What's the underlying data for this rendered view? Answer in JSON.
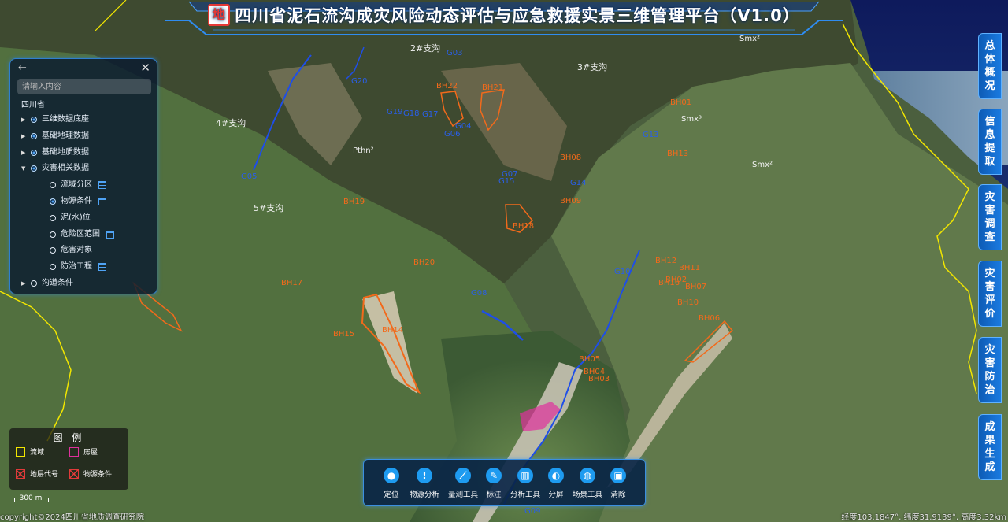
{
  "app": {
    "title": "四川省泥石流沟成灾风险动态评估与应急救援实景三维管理平台（V1.0）",
    "logo_char": "地",
    "accent_color": "#1a7ae0",
    "title_glow_color": "#0a3b8c"
  },
  "layer_panel": {
    "search_placeholder": "请输入内容",
    "root_label": "四川省",
    "back_icon": "arrow-left-icon",
    "close_icon": "close-icon",
    "items": [
      {
        "label": "三维数据底座",
        "checked": true,
        "expand": "collapsed",
        "level": 1,
        "table_icon": false
      },
      {
        "label": "基础地理数据",
        "checked": true,
        "expand": "collapsed",
        "level": 1,
        "table_icon": false
      },
      {
        "label": "基础地质数据",
        "checked": true,
        "expand": "collapsed",
        "level": 1,
        "table_icon": false
      },
      {
        "label": "灾害相关数据",
        "checked": true,
        "expand": "expanded",
        "level": 1,
        "table_icon": false
      },
      {
        "label": "流域分区",
        "checked": false,
        "expand": "none",
        "level": 2,
        "table_icon": true
      },
      {
        "label": "物源条件",
        "checked": true,
        "expand": "none",
        "level": 2,
        "table_icon": true
      },
      {
        "label": "泥(水)位",
        "checked": false,
        "expand": "none",
        "level": 2,
        "table_icon": false
      },
      {
        "label": "危险区范围",
        "checked": false,
        "expand": "none",
        "level": 2,
        "table_icon": true
      },
      {
        "label": "危害对象",
        "checked": false,
        "expand": "none",
        "level": 2,
        "table_icon": false
      },
      {
        "label": "防治工程",
        "checked": false,
        "expand": "none",
        "level": 2,
        "table_icon": true
      },
      {
        "label": "沟道条件",
        "checked": false,
        "expand": "collapsed",
        "level": 1,
        "table_icon": false
      }
    ]
  },
  "legend": {
    "title": "图 例",
    "items": [
      {
        "label": "流域",
        "color": "#f2e600",
        "style": "border"
      },
      {
        "label": "房屋",
        "color": "#e0309c",
        "style": "border"
      },
      {
        "label": "地层代号",
        "color": "#e03a3a",
        "style": "cross"
      },
      {
        "label": "物源条件",
        "color": "#e03a3a",
        "style": "cross"
      }
    ]
  },
  "scale_bar": {
    "label": "300 m"
  },
  "footer": {
    "copyright": "copyright©2024四川省地质调查研究院",
    "coordinates": "经度103.1847°, 纬度31.9139°, 高度3.32km"
  },
  "side_tabs": [
    "总体概况",
    "信息提取",
    "灾害调查",
    "灾害评价",
    "灾害防治",
    "成果生成"
  ],
  "toolbar": [
    {
      "label": "定位",
      "icon": "location-pin-icon",
      "glyph": "●"
    },
    {
      "label": "物源分析",
      "icon": "alert-icon",
      "glyph": "!"
    },
    {
      "label": "量测工具",
      "icon": "ruler-icon",
      "glyph": "⟋"
    },
    {
      "label": "标注",
      "icon": "pen-icon",
      "glyph": "✎"
    },
    {
      "label": "分析工具",
      "icon": "chart-bars-icon",
      "glyph": "▥"
    },
    {
      "label": "分屏",
      "icon": "split-screen-icon",
      "glyph": "◐"
    },
    {
      "label": "场景工具",
      "icon": "globe-icon",
      "glyph": "◍"
    },
    {
      "label": "清除",
      "icon": "trash-icon",
      "glyph": "▣"
    }
  ],
  "map_labels": {
    "branches": [
      "2#支沟",
      "3#支沟",
      "4#支沟",
      "5#支沟"
    ],
    "strata": [
      "Smx²",
      "Smx³",
      "Smx²",
      "Pthn²"
    ],
    "gullies": [
      "G03",
      "G20",
      "G19",
      "G18",
      "G17",
      "G04",
      "G06",
      "G05",
      "G13",
      "G07",
      "G15",
      "G14",
      "G08",
      "G10",
      "G09"
    ],
    "sources": [
      "BH22",
      "BH21",
      "BH01",
      "BH13",
      "BH18",
      "BH20",
      "BH12",
      "BH11",
      "BH16",
      "BH10",
      "BH02",
      "BH06",
      "BH15",
      "BH14",
      "BH05",
      "BH04",
      "BH03",
      "BH08",
      "BH09",
      "BH17",
      "BH07",
      "BH19"
    ]
  },
  "map_colors": {
    "gully_label": "#2a5fe8",
    "source_label": "#f26a1b",
    "basin_boundary": "#f2e600",
    "stream": "#1e4ee8",
    "house": "#e0309c"
  }
}
